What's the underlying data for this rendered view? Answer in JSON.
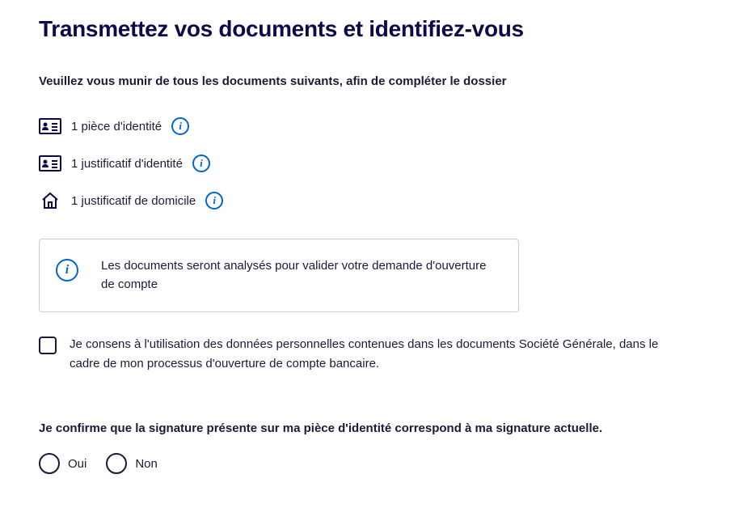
{
  "title": "Transmettez vos documents et identifiez-vous",
  "intro": "Veuillez vous munir de tous les documents suivants, afin de compléter le dossier",
  "documents": [
    {
      "label": "1 pièce d'identité",
      "icon": "id-card"
    },
    {
      "label": "1 justificatif d'identité",
      "icon": "id-card"
    },
    {
      "label": "1 justificatif de domicile",
      "icon": "house"
    }
  ],
  "info_box": "Les documents seront analysés pour valider votre demande d'ouverture de compte",
  "consent_text": "Je consens à l'utilisation des données personnelles contenues dans les documents Société Générale, dans le cadre de mon processus d'ouverture de compte bancaire.",
  "signature_question": "Je confirme que la signature présente sur ma pièce d'identité correspond à ma signature actuelle.",
  "radio_yes": "Oui",
  "radio_no": "Non"
}
